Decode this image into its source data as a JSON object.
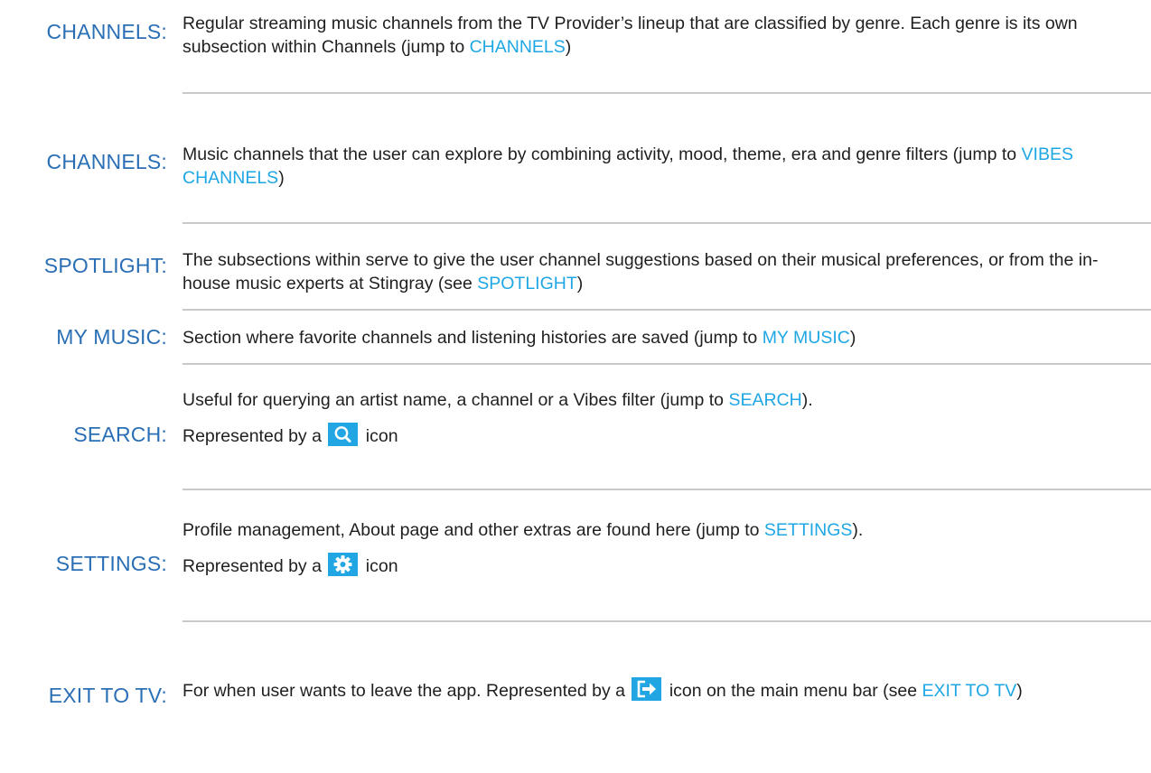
{
  "rows": [
    {
      "term": "CHANNELS:",
      "desc_before": "Regular streaming music channels from the TV Provider’s lineup that are classified by genre. Each genre is its own subsection within Channels (jump to ",
      "link": "CHANNELS",
      "desc_after": ")"
    },
    {
      "term": "CHANNELS:",
      "desc_before": "Music channels that the user can explore by combining activity, mood, theme, era and genre filters (jump to ",
      "link": "VIBES CHANNELS",
      "desc_after": ")"
    },
    {
      "term": "SPOTLIGHT:",
      "desc_before": "The subsections within serve to give the user channel suggestions based on their musical preferences, or from the in-house music experts at Stingray (see ",
      "link": "SPOTLIGHT",
      "desc_after": ")"
    },
    {
      "term": "MY MUSIC:",
      "desc_before": "Section where favorite channels and listening histories are saved (jump to ",
      "link": "MY MUSIC",
      "desc_after": ")"
    },
    {
      "term": "SEARCH:",
      "desc_before": "Useful for querying an artist name, a channel or a Vibes filter (jump to ",
      "link": "SEARCH",
      "desc_after": ").",
      "rep_before": "Represented by a",
      "rep_after": "icon",
      "icon": "search-icon"
    },
    {
      "term": "SETTINGS:",
      "desc_before": "Profile management, About page and other extras are found here (jump to ",
      "link": "SETTINGS",
      "desc_after": ").",
      "rep_before": "Represented by a",
      "rep_after": "icon",
      "icon": "gear-icon"
    },
    {
      "term": "EXIT TO TV:",
      "desc_before": "For when user wants to leave the app. Represented by a",
      "icon": "exit-icon",
      "desc_mid": "icon on the main menu bar (see ",
      "link": "EXIT TO TV",
      "desc_after": ")"
    }
  ],
  "colors": {
    "term": "#2a6fb5",
    "link": "#1ea7e4",
    "icon_bg": "#22a6e3",
    "divider": "#c9c9c9"
  }
}
